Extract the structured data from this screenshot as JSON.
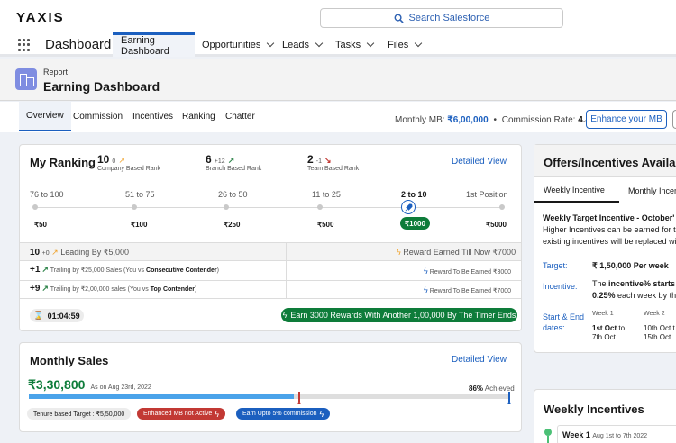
{
  "header": {
    "logo": "YAXIS",
    "search_placeholder": "Search Salesforce"
  },
  "nav": {
    "app_name": "Dashboard",
    "tabs": [
      {
        "label": "Earning Dashboard",
        "active": true,
        "dropdown": false
      },
      {
        "label": "Opportunities",
        "dropdown": true
      },
      {
        "label": "Leads",
        "dropdown": true
      },
      {
        "label": "Tasks",
        "dropdown": true
      },
      {
        "label": "Files",
        "dropdown": true
      }
    ]
  },
  "page": {
    "object_label": "Report",
    "title": "Earning Dashboard"
  },
  "subtabs": [
    "Overview",
    "Commission",
    "Incentives",
    "Ranking",
    "Chatter"
  ],
  "summary": {
    "mb_label": "Monthly MB:",
    "mb_value": "₹6,00,000",
    "separator": "•",
    "rate_label": "Commission Rate:",
    "rate_value": "4.4%",
    "enhance_button": "Enhance your MB"
  },
  "ranking": {
    "title": "My Ranking",
    "detail_link": "Detailed View",
    "ranks": [
      {
        "value": "10",
        "delta": "0",
        "label": "Company Based Rank",
        "trend": "flat"
      },
      {
        "value": "6",
        "delta": "+12",
        "label": "Branch Based Rank",
        "trend": "up"
      },
      {
        "value": "2",
        "delta": "-1",
        "label": "Team Based Rank",
        "trend": "down"
      }
    ],
    "scale": [
      {
        "range": "76 to 100",
        "reward": "₹50"
      },
      {
        "range": "51 to 75",
        "reward": "₹100"
      },
      {
        "range": "26 to 50",
        "reward": "₹250"
      },
      {
        "range": "11 to 25",
        "reward": "₹500"
      },
      {
        "range": "2 to 10",
        "reward": "₹1000",
        "current": true
      },
      {
        "range": "1st Position",
        "reward": "₹5000"
      }
    ],
    "summary_row": {
      "rank": "10",
      "delta": "+0",
      "leading_text": "Leading By ₹5,000",
      "reward_earned": "Reward Earned Till Now ₹7000"
    },
    "rows": [
      {
        "delta": "+1",
        "text_pre": "Trailing by ₹25,000 Sales (You vs ",
        "bold": "Consecutive Contender",
        "text_post": ")",
        "reward": "Reward To Be Earned ₹3000"
      },
      {
        "delta": "+9",
        "text_pre": "Trailing by ₹2,00,000 sales (You vs ",
        "bold": "Top Contender",
        "text_post": ")",
        "reward": "Reward To Be Earned ₹7000"
      }
    ],
    "timer": "01:04:59",
    "earn_banner": "Earn 3000 Rewards With Another 1,00,000 By The Timer Ends"
  },
  "sales": {
    "title": "Monthly Sales",
    "detail_link": "Detailed View",
    "amount": "₹3,30,800",
    "as_on": "As on Aug 23rd, 2022",
    "achieved_pct": "86%",
    "achieved_label": "Achieved",
    "progress_fraction": 0.55,
    "target_pill": "Tenure based Target : ₹5,50,000",
    "enhanced_pill": "Enhanced MB not Active",
    "commission_pill": "Earn Upto 5% commission"
  },
  "offers": {
    "title": "Offers/Incentives Available T",
    "tabs": [
      "Weekly Incentive",
      "Monthly Incen"
    ],
    "heading": "Weekly Target Incentive - October'",
    "desc_line1": "Higher Incentives can be earned for th",
    "desc_line2": "existing incentives will be replaced wit",
    "target_label": "Target:",
    "target_value": "₹ 1,50,000 Per week",
    "incentive_label": "Incentive:",
    "incentive_pre": "The ",
    "incentive_bold1": "incentive% starts",
    "incentive_bold2": "0.25%",
    "incentive_post": " each week by th",
    "dates_label1": "Start & End",
    "dates_label2": "dates:",
    "weeks": [
      {
        "label": "Week 1",
        "start": "1st Oct",
        "end_pre": "to",
        "end": "7th Oct"
      },
      {
        "label": "Week 2",
        "start": "10th Oct t",
        "end": "15th Oct"
      }
    ]
  },
  "weekly": {
    "title": "Weekly Incentives",
    "item_label": "Week 1",
    "item_dates": "Aug 1st to 7th 2022"
  },
  "colors": {
    "brand_blue": "#1b5fbf",
    "green": "#0e7c3a",
    "red": "#c23934",
    "progress": "#4aa3ea"
  }
}
